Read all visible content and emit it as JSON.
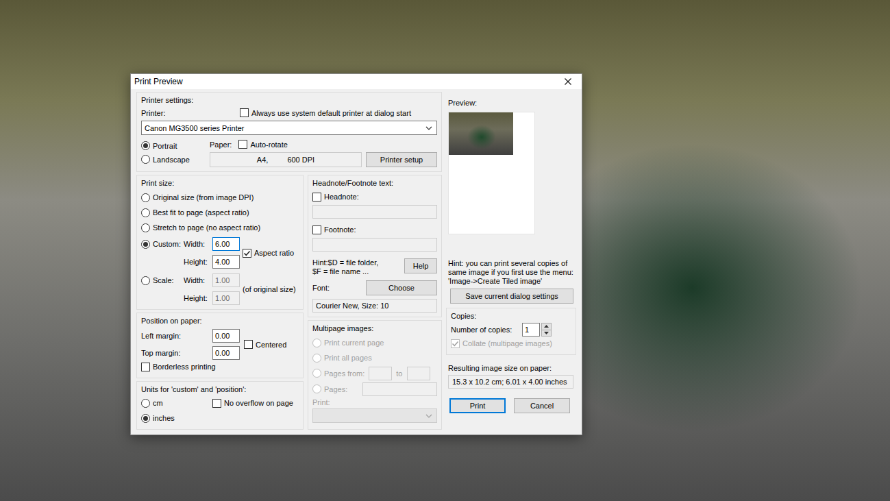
{
  "window": {
    "title": "Print Preview"
  },
  "printer_settings": {
    "title": "Printer settings:",
    "printer_label": "Printer:",
    "always_default": {
      "label": "Always use system default printer at dialog start",
      "checked": false
    },
    "printer": "Canon MG3500 series Printer",
    "orientation": [
      {
        "label": "Portrait",
        "selected": true
      },
      {
        "label": "Landscape",
        "selected": false
      }
    ],
    "paper_label": "Paper:",
    "auto_rotate": {
      "label": "Auto-rotate",
      "checked": false
    },
    "paper_size": "A4,",
    "dpi": "600 DPI",
    "setup_button": "Printer setup"
  },
  "print_size": {
    "title": "Print size:",
    "options": [
      {
        "label": "Original size (from image DPI)",
        "selected": false,
        "kind": "plain"
      },
      {
        "label": "Best fit to page (aspect ratio)",
        "selected": false,
        "kind": "plain"
      },
      {
        "label": "Stretch to page (no aspect ratio)",
        "selected": false,
        "kind": "plain"
      },
      {
        "label": "Custom:",
        "selected": true,
        "kind": "custom"
      },
      {
        "label": "Scale:",
        "selected": false,
        "kind": "scale"
      }
    ],
    "custom": {
      "width_label": "Width:",
      "width": "6.00",
      "width_focused": true,
      "height_label": "Height:",
      "height": "4.00",
      "aspect": {
        "label": "Aspect ratio",
        "checked": true
      }
    },
    "scale": {
      "width_label": "Width:",
      "width": "1.00",
      "height_label": "Height:",
      "height": "1.00",
      "note": "(of original size)",
      "disabled": true
    }
  },
  "position": {
    "title": "Position on paper:",
    "left_label": "Left margin:",
    "left": "0.00",
    "top_label": "Top margin:",
    "top": "0.00",
    "centered": {
      "label": "Centered",
      "checked": false
    },
    "borderless": {
      "label": "Borderless printing",
      "checked": false
    }
  },
  "units": {
    "title": "Units for 'custom' and 'position':",
    "options": [
      {
        "label": "cm",
        "selected": false
      },
      {
        "label": "inches",
        "selected": true
      }
    ],
    "no_overflow": {
      "label": "No overflow on page",
      "checked": false
    }
  },
  "notes": {
    "title": "Headnote/Footnote text:",
    "items": [
      {
        "label": "Headnote:",
        "checked": false,
        "value": "",
        "field_disabled": true
      },
      {
        "label": "Footnote:",
        "checked": false,
        "value": "",
        "field_disabled": true
      }
    ],
    "hint": [
      "Hint:$D = file folder,",
      "$F = file name ..."
    ],
    "help_button": "Help",
    "font_label": "Font:",
    "choose_button": "Choose",
    "font": "Courier New, Size: 10"
  },
  "multipage": {
    "title": "Multipage images:",
    "disabled": true,
    "options": [
      {
        "label": "Print current page",
        "selected": false,
        "kind": "plain"
      },
      {
        "label": "Print all pages",
        "selected": false,
        "kind": "plain"
      },
      {
        "label": "Pages from:",
        "selected": false,
        "kind": "range"
      },
      {
        "label": "Pages:",
        "selected": false,
        "kind": "list"
      }
    ],
    "range": {
      "from": "",
      "to_label": "to",
      "to": ""
    },
    "pages_value": "",
    "print_label": "Print:",
    "print_value": ""
  },
  "preview": {
    "title": "Preview:"
  },
  "hint": [
    "Hint: you can print several copies of",
    "same image if you first use the menu:",
    "'Image->Create Tiled image'"
  ],
  "save_button": "Save current dialog settings",
  "copies": {
    "title": "Copies:",
    "label": "Number of copies:",
    "value": "1",
    "collate": {
      "label": "Collate (multipage images)",
      "checked": true,
      "disabled": true
    }
  },
  "result": {
    "label": "Resulting image size on paper:",
    "value": "15.3 x 10.2 cm; 6.01 x 4.00 inches"
  },
  "buttons": [
    {
      "label": "Print",
      "default": true
    },
    {
      "label": "Cancel",
      "default": false
    }
  ]
}
